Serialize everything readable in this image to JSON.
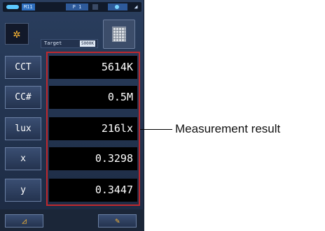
{
  "status": {
    "memory": "M11",
    "channel": "P 1"
  },
  "header": {
    "sun_icon": "sun-icon",
    "target_label": "Target",
    "target_value": "5000K",
    "grid_icon": "grid-icon"
  },
  "rows": [
    {
      "label": "CCT",
      "value": "5614K"
    },
    {
      "label": "CC#",
      "value": "0.5M"
    },
    {
      "label": "lux",
      "value": "216lx"
    },
    {
      "label": "x",
      "value": "0.3298"
    },
    {
      "label": "y",
      "value": "0.3447"
    }
  ],
  "bottom": {
    "left_icon": "triangle-icon",
    "right_icon": "wrench-icon"
  },
  "callout": {
    "text": "Measurement result"
  },
  "colors": {
    "highlight": "#c0282d",
    "accent": "#ffb933",
    "panel": "#24334f"
  }
}
